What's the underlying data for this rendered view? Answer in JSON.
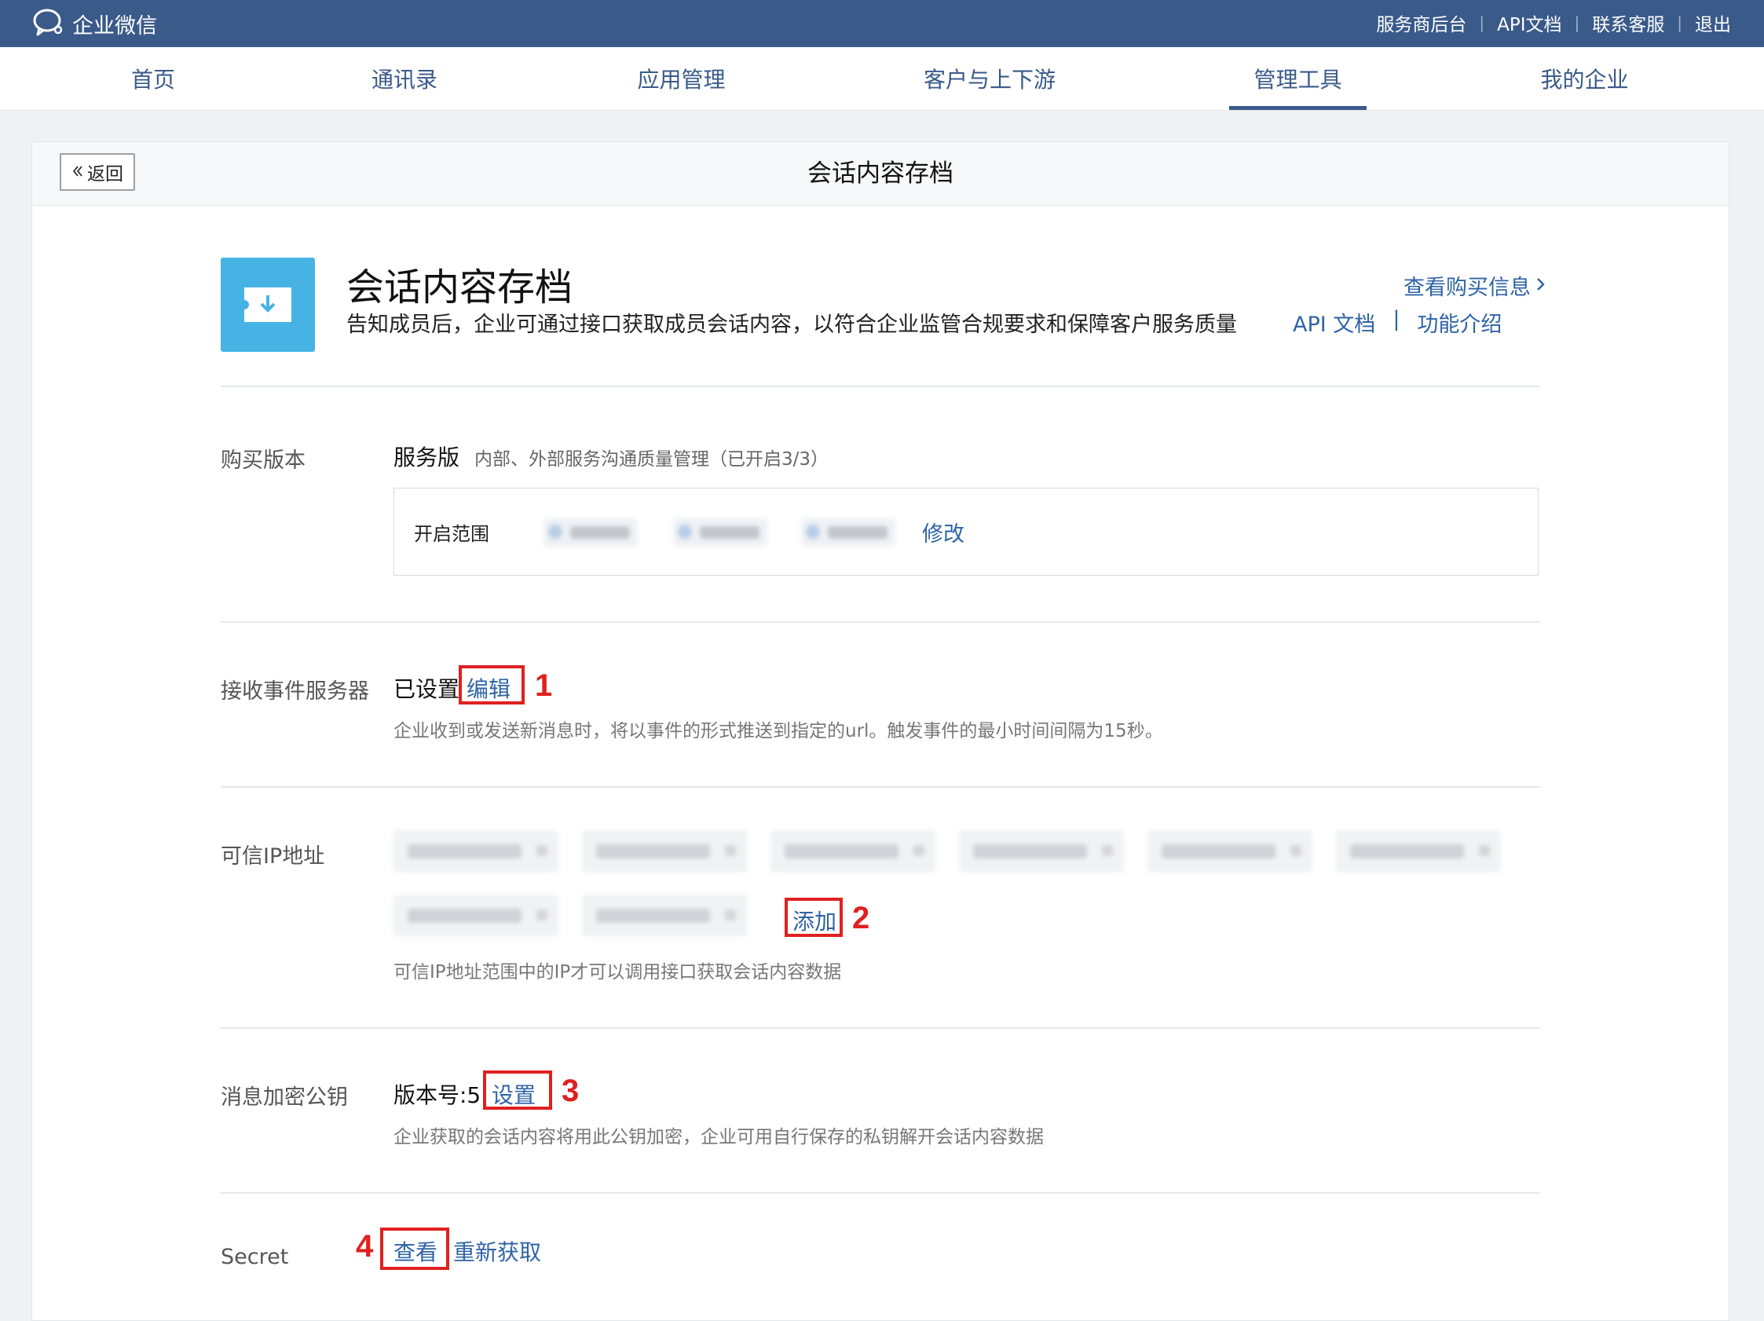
{
  "topbar": {
    "brand": "企业微信",
    "links": [
      "服务商后台",
      "API文档",
      "联系客服",
      "退出"
    ]
  },
  "nav": {
    "items": [
      "首页",
      "通讯录",
      "应用管理",
      "客户与上下游",
      "管理工具",
      "我的企业"
    ],
    "active": "管理工具"
  },
  "card": {
    "back_label": "返回",
    "title": "会话内容存档"
  },
  "app": {
    "title": "会话内容存档",
    "description": "告知成员后，企业可通过接口获取成员会话内容，以符合企业监管合规要求和保障客户服务质量",
    "purchase_link": "查看购买信息",
    "api_doc": "API 文档",
    "doc_sep": "|",
    "feature_intro": "功能介绍"
  },
  "purchase": {
    "label": "购买版本",
    "edition": "服务版",
    "edition_desc": "内部、外部服务沟通质量管理（已开启3/3）",
    "range_label": "开启范围",
    "modify": "修改"
  },
  "event_server": {
    "label": "接收事件服务器",
    "status": "已设置",
    "edit": "编辑",
    "desc": "企业收到或发送新消息时，将以事件的形式推送到指定的url。触发事件的最小时间间隔为15秒。"
  },
  "trusted_ip": {
    "label": "可信IP地址",
    "add": "添加",
    "desc": "可信IP地址范围中的IP才可以调用接口获取会话内容数据"
  },
  "pubkey": {
    "label": "消息加密公钥",
    "version": "版本号:5",
    "set": "设置",
    "desc": "企业获取的会话内容将用此公钥加密，企业可用自行保存的私钥解开会话内容数据"
  },
  "secret": {
    "label": "Secret",
    "view": "查看",
    "refresh": "重新获取"
  },
  "annotations": [
    "1",
    "2",
    "3",
    "4"
  ],
  "colors": {
    "topbar": "#3a5a8a",
    "link": "#2f63a6",
    "annotation": "#e02020",
    "app_icon": "#47b3e5"
  }
}
